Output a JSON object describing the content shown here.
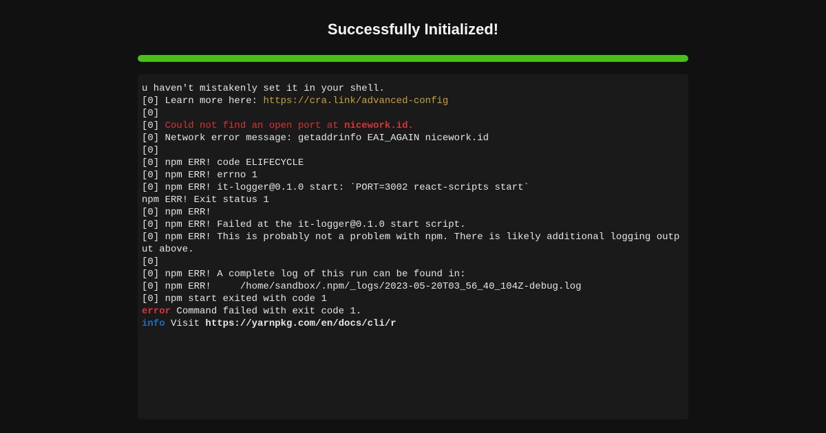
{
  "header": {
    "title": "Successfully Initialized!"
  },
  "progress": {
    "percent": 100
  },
  "terminal": {
    "lines": [
      {
        "segments": [
          {
            "text": "u haven't mistakenly set it in your shell."
          }
        ]
      },
      {
        "segments": [
          {
            "text": "[0] Learn more here: "
          },
          {
            "text": "https://cra.link/advanced-config",
            "cls": "link"
          }
        ]
      },
      {
        "segments": [
          {
            "text": "[0]"
          }
        ]
      },
      {
        "segments": [
          {
            "text": "[0] "
          },
          {
            "text": "Could not find an open port at ",
            "cls": "err-red"
          },
          {
            "text": "nicework.id",
            "cls": "err-red-b"
          },
          {
            "text": ".",
            "cls": "err-red-b"
          }
        ]
      },
      {
        "segments": [
          {
            "text": "[0] Network error message: getaddrinfo EAI_AGAIN nicework.id"
          }
        ]
      },
      {
        "segments": [
          {
            "text": "[0]"
          }
        ]
      },
      {
        "segments": [
          {
            "text": "[0] npm ERR! code ELIFECYCLE"
          }
        ]
      },
      {
        "segments": [
          {
            "text": "[0] npm ERR! errno 1"
          }
        ]
      },
      {
        "segments": [
          {
            "text": "[0] npm ERR! it-logger@0.1.0 start: `PORT=3002 react-scripts start`"
          }
        ]
      },
      {
        "segments": [
          {
            "text": "npm ERR! Exit status 1"
          }
        ]
      },
      {
        "segments": [
          {
            "text": "[0] npm ERR!"
          }
        ]
      },
      {
        "segments": [
          {
            "text": "[0] npm ERR! Failed at the it-logger@0.1.0 start script."
          }
        ]
      },
      {
        "segments": [
          {
            "text": "[0] npm ERR! This is probably not a problem with npm. There is likely additional logging output above."
          }
        ]
      },
      {
        "segments": [
          {
            "text": "[0]"
          }
        ]
      },
      {
        "segments": [
          {
            "text": "[0] npm ERR! A complete log of this run can be found in:"
          }
        ]
      },
      {
        "segments": [
          {
            "text": "[0] npm ERR!     /home/sandbox/.npm/_logs/2023-05-20T03_56_40_104Z-debug.log"
          }
        ]
      },
      {
        "segments": [
          {
            "text": "[0] npm start exited with code 1"
          }
        ]
      },
      {
        "segments": [
          {
            "text": "error",
            "cls": "err-label"
          },
          {
            "text": " Command failed with exit code 1."
          }
        ]
      },
      {
        "segments": [
          {
            "text": "info",
            "cls": "info-label"
          },
          {
            "text": " Visit "
          },
          {
            "text": "https://yarnpkg.com/en/docs/cli/r",
            "cls": "bold"
          }
        ]
      }
    ]
  }
}
